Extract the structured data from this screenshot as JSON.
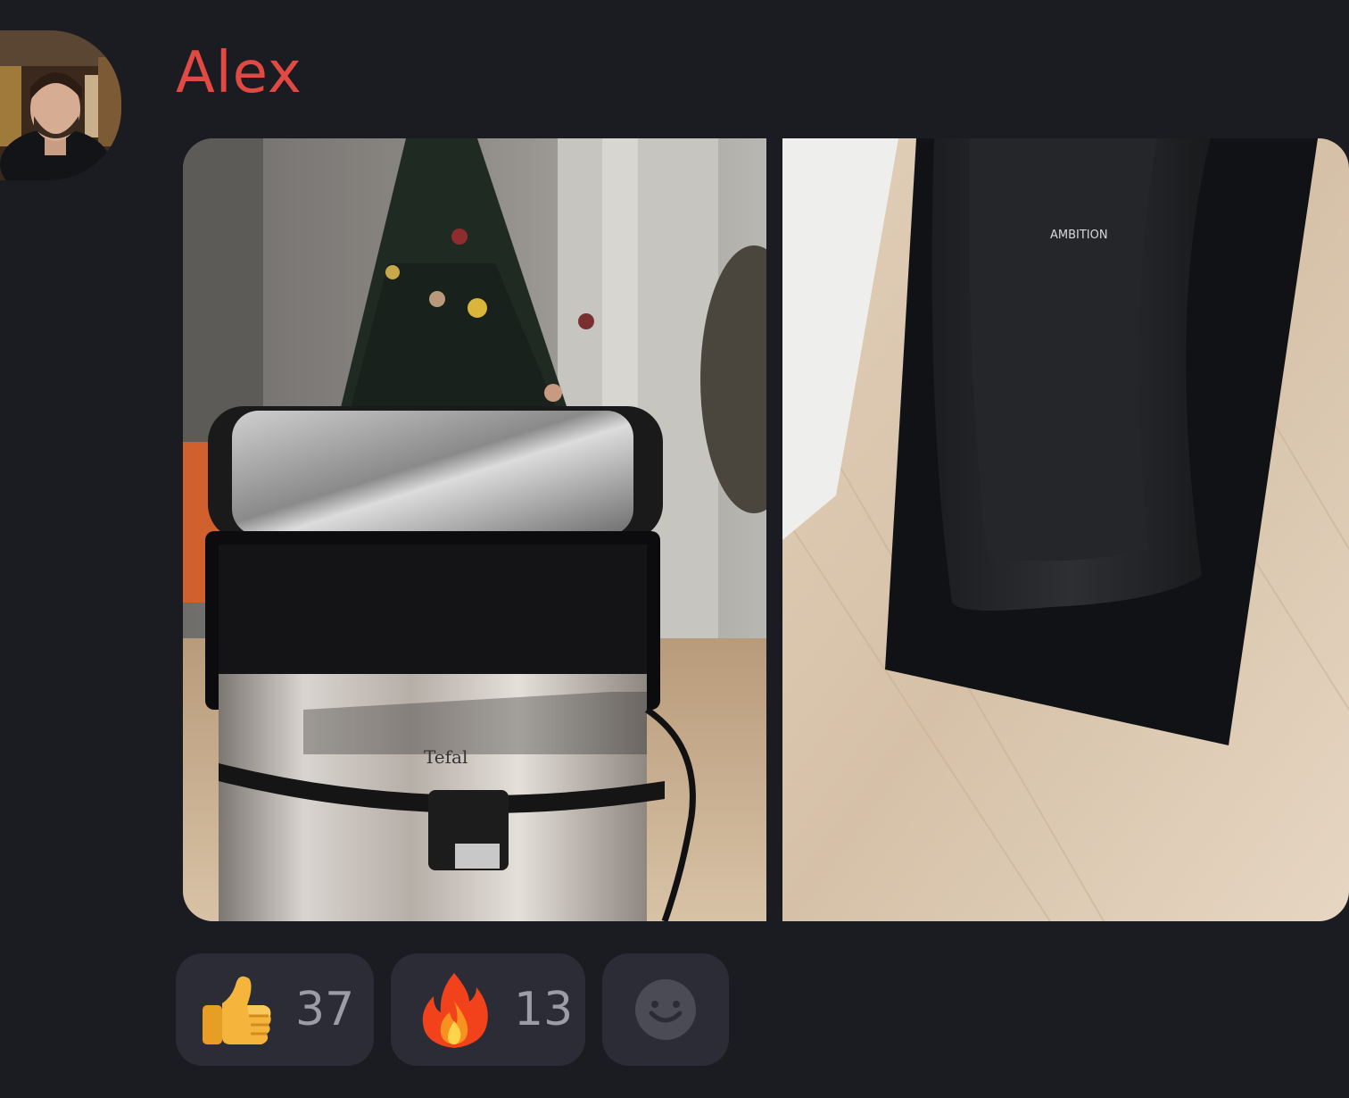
{
  "message": {
    "author": "Alex",
    "author_color": "#e04a43",
    "photos": [
      {
        "name": "air-fryer-photo",
        "alt": "Tefal"
      },
      {
        "name": "accessory-photo",
        "alt": "AMBITION"
      }
    ]
  },
  "reactions": [
    {
      "emoji": "thumbs-up-icon",
      "count": "37"
    },
    {
      "emoji": "fire-icon",
      "count": "13"
    },
    {
      "emoji": "add-reaction-icon",
      "count": ""
    }
  ],
  "colors": {
    "background": "#1b1c22",
    "reaction_bg": "#2b2c35",
    "count_text": "#9b9ca6"
  }
}
